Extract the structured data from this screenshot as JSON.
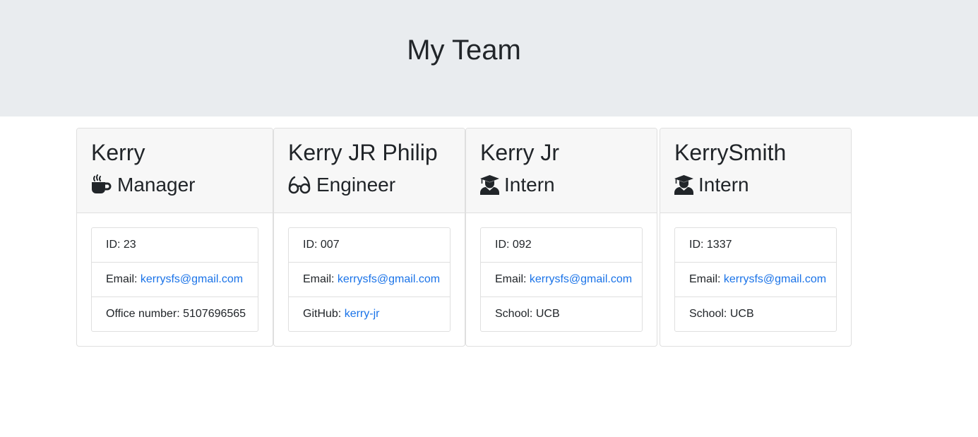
{
  "header": {
    "title": "My Team"
  },
  "members": [
    {
      "name": "Kerry",
      "role": "Manager",
      "icon": "mug-icon",
      "id_label": "ID: ",
      "id": "23",
      "email_label": "Email: ",
      "email": "kerrysfs@gmail.com",
      "extra_label": "Office number: ",
      "extra": "5107696565"
    },
    {
      "name": "Kerry JR Philip",
      "role": "Engineer",
      "icon": "glasses-icon",
      "id_label": "ID: ",
      "id": "007",
      "email_label": "Email: ",
      "email": "kerrysfs@gmail.com",
      "extra_label": "GitHub: ",
      "extra": "kerry-jr"
    },
    {
      "name": "Kerry Jr",
      "role": "Intern",
      "icon": "graduate-icon",
      "id_label": "ID: ",
      "id": "092",
      "email_label": "Email: ",
      "email": "kerrysfs@gmail.com",
      "extra_label": "School: ",
      "extra": "UCB"
    },
    {
      "name": "KerrySmith",
      "role": "Intern",
      "icon": "graduate-icon",
      "id_label": "ID: ",
      "id": "1337",
      "email_label": "Email: ",
      "email": "kerrysfs@gmail.com",
      "extra_label": "School: ",
      "extra": "UCB"
    }
  ],
  "colors": {
    "header_bg": "#e9ecef",
    "card_header_bg": "#f7f7f7",
    "link": "#1a73e8",
    "text": "#212529"
  }
}
